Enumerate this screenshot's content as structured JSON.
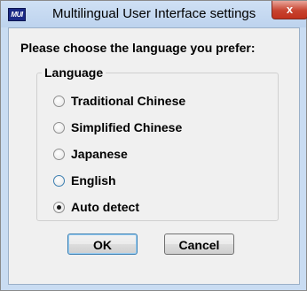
{
  "window": {
    "title": "Multilingual User Interface settings",
    "app_icon_text": "MUI",
    "close_label": "x"
  },
  "dialog": {
    "prompt": "Please choose the language you prefer:",
    "group_label": "Language",
    "options": [
      {
        "label": "Traditional Chinese",
        "selected": false
      },
      {
        "label": "Simplified Chinese",
        "selected": false
      },
      {
        "label": "Japanese",
        "selected": false
      },
      {
        "label": "English",
        "selected": false
      },
      {
        "label": "Auto detect",
        "selected": true
      }
    ],
    "selected_value": "Auto detect"
  },
  "buttons": {
    "ok_label": "OK",
    "cancel_label": "Cancel"
  },
  "colors": {
    "title_bar": "#c9dcf2",
    "close_button": "#c7432f",
    "dialog_bg": "#f0f0f0",
    "focus_accent": "#3c7fb1"
  }
}
